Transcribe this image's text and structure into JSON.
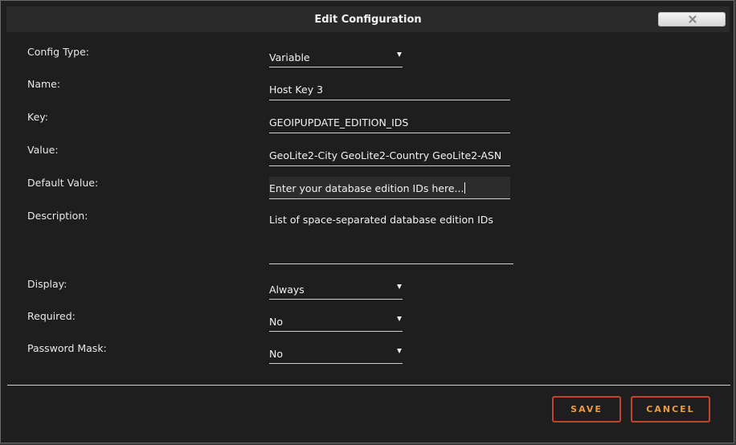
{
  "dialog": {
    "title": "Edit Configuration"
  },
  "form": {
    "config_type": {
      "label": "Config Type:",
      "value": "Variable"
    },
    "name": {
      "label": "Name:",
      "value": "Host Key 3"
    },
    "key": {
      "label": "Key:",
      "value": "GEOIPUPDATE_EDITION_IDS"
    },
    "value": {
      "label": "Value:",
      "value": "GeoLite2-City GeoLite2-Country GeoLite2-ASN"
    },
    "default_value": {
      "label": "Default Value:",
      "value": "Enter your database edition IDs here..."
    },
    "description": {
      "label": "Description:",
      "value": "List of space-separated database edition IDs"
    },
    "display": {
      "label": "Display:",
      "value": "Always"
    },
    "required": {
      "label": "Required:",
      "value": "No"
    },
    "password_mask": {
      "label": "Password Mask:",
      "value": "No"
    }
  },
  "buttons": {
    "save": "SAVE",
    "cancel": "CANCEL"
  },
  "icons": {
    "close": "close-icon",
    "dropdown": "caret-down-icon"
  },
  "colors": {
    "background": "#1e1e1e",
    "titlebar": "#2a2a2a",
    "button_border": "#c4432b",
    "button_text": "#f09a3a"
  }
}
